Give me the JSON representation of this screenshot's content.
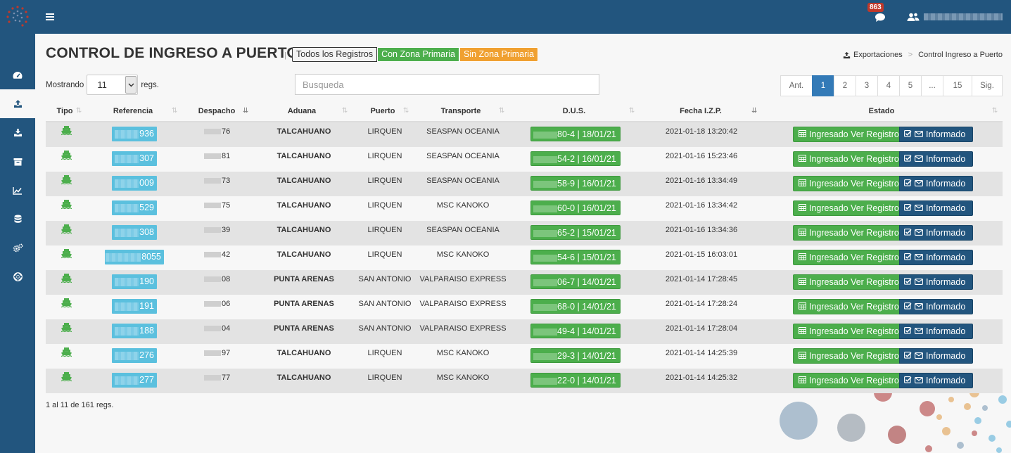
{
  "topbar": {
    "notifications_count": "863"
  },
  "sidebar": {
    "items": [
      "dashboard-icon",
      "upload-icon",
      "download-icon",
      "archive-icon",
      "chart-icon",
      "database-icon",
      "cogs-icon",
      "lifebuoy-icon"
    ],
    "active_index": 1
  },
  "page": {
    "title": "CONTROL DE INGRESO A PUERTO",
    "separator": "|",
    "filters": {
      "all": "Todos los Registros",
      "con": "Con Zona Primaria",
      "sin": "Sin Zona Primaria"
    },
    "breadcrumb": {
      "first": "Exportaciones",
      "sep": ">",
      "second": "Control Ingreso a Puerto"
    }
  },
  "controls": {
    "showing_label": "Mostrando",
    "page_size": "11",
    "regs_label": "regs.",
    "search_placeholder": "Busqueda"
  },
  "pagination": {
    "prev": "Ant.",
    "pages": [
      "1",
      "2",
      "3",
      "4",
      "5",
      "...",
      "15"
    ],
    "next": "Sig.",
    "current": "1"
  },
  "table": {
    "columns": {
      "tipo": "Tipo",
      "referencia": "Referencia",
      "despacho": "Despacho",
      "aduana": "Aduana",
      "puerto": "Puerto",
      "transporte": "Transporte",
      "dus": "D.U.S.",
      "fecha": "Fecha I.Z.P.",
      "estado": "Estado"
    },
    "buttons": {
      "ingresado": "Ingresado Ver Registro",
      "informado": "Informado"
    },
    "rows": [
      {
        "ref": "936",
        "desp": "76",
        "aduana": "TALCAHUANO",
        "puerto": "LIRQUEN",
        "transporte": "SEASPAN OCEANIA",
        "dus": "80-4 | 18/01/21",
        "fecha": "2021-01-18 13:20:42"
      },
      {
        "ref": "307",
        "desp": "81",
        "aduana": "TALCAHUANO",
        "puerto": "LIRQUEN",
        "transporte": "SEASPAN OCEANIA",
        "dus": "54-2 | 16/01/21",
        "fecha": "2021-01-16 15:23:46"
      },
      {
        "ref": "009",
        "desp": "73",
        "aduana": "TALCAHUANO",
        "puerto": "LIRQUEN",
        "transporte": "SEASPAN OCEANIA",
        "dus": "58-9 | 16/01/21",
        "fecha": "2021-01-16 13:34:49"
      },
      {
        "ref": "529",
        "desp": "75",
        "aduana": "TALCAHUANO",
        "puerto": "LIRQUEN",
        "transporte": "MSC KANOKO",
        "dus": "60-0 | 16/01/21",
        "fecha": "2021-01-16 13:34:42"
      },
      {
        "ref": "308",
        "desp": "39",
        "aduana": "TALCAHUANO",
        "puerto": "LIRQUEN",
        "transporte": "SEASPAN OCEANIA",
        "dus": "65-2 | 15/01/21",
        "fecha": "2021-01-16 13:34:36"
      },
      {
        "ref": "8055",
        "desp": "42",
        "aduana": "TALCAHUANO",
        "puerto": "LIRQUEN",
        "transporte": "MSC KANOKO",
        "dus": "54-6 | 15/01/21",
        "fecha": "2021-01-15 16:03:01"
      },
      {
        "ref": "190",
        "desp": "08",
        "aduana": "PUNTA ARENAS",
        "puerto": "SAN ANTONIO",
        "transporte": "VALPARAISO EXPRESS",
        "dus": "06-7 | 14/01/21",
        "fecha": "2021-01-14 17:28:45"
      },
      {
        "ref": "191",
        "desp": "06",
        "aduana": "PUNTA ARENAS",
        "puerto": "SAN ANTONIO",
        "transporte": "VALPARAISO EXPRESS",
        "dus": "68-0 | 14/01/21",
        "fecha": "2021-01-14 17:28:24"
      },
      {
        "ref": "188",
        "desp": "04",
        "aduana": "PUNTA ARENAS",
        "puerto": "SAN ANTONIO",
        "transporte": "VALPARAISO EXPRESS",
        "dus": "49-4 | 14/01/21",
        "fecha": "2021-01-14 17:28:04"
      },
      {
        "ref": "276",
        "desp": "97",
        "aduana": "TALCAHUANO",
        "puerto": "LIRQUEN",
        "transporte": "MSC KANOKO",
        "dus": "29-3 | 14/01/21",
        "fecha": "2021-01-14 14:25:39"
      },
      {
        "ref": "277",
        "desp": "77",
        "aduana": "TALCAHUANO",
        "puerto": "LIRQUEN",
        "transporte": "MSC KANOKO",
        "dus": "22-0 | 14/01/21",
        "fecha": "2021-01-14 14:25:32"
      }
    ]
  },
  "footer": {
    "count_text": "1 al 11 de 161 regs."
  },
  "colors": {
    "primary": "#22557e",
    "success": "#4cae4c",
    "warning": "#f0a030",
    "info": "#5bc0de",
    "pager_active": "#337ab7"
  }
}
